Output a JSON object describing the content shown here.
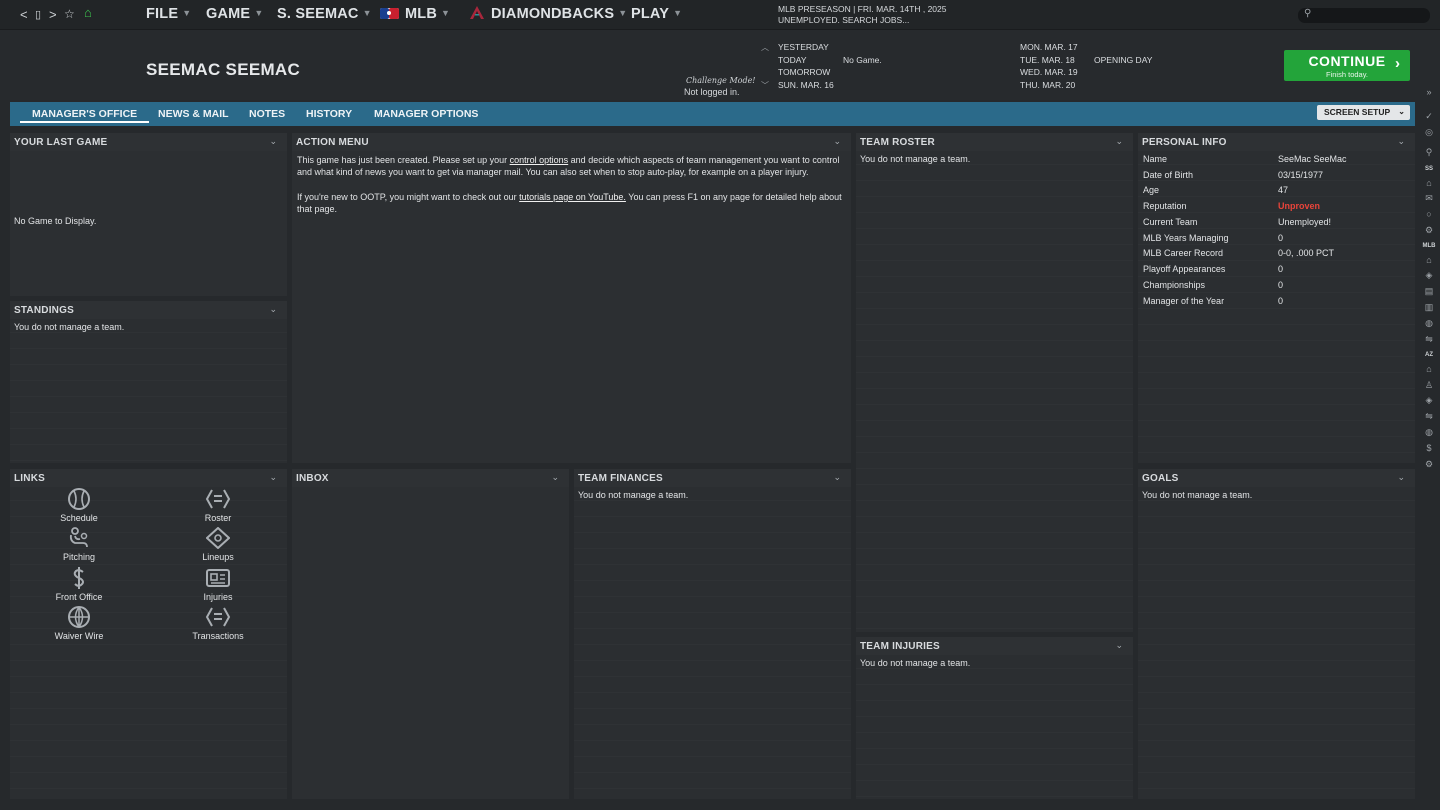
{
  "nav": {
    "back": "<",
    "forward": ">",
    "menus": [
      {
        "label": "FILE"
      },
      {
        "label": "GAME"
      },
      {
        "label": "S. SEEMAC"
      },
      {
        "label": "MLB"
      },
      {
        "label": "DIAMONDBACKS"
      },
      {
        "label": "PLAY"
      }
    ]
  },
  "status": {
    "line1": "MLB PRESEASON  |  FRI. MAR. 14TH , 2025",
    "line2": "UNEMPLOYED. SEARCH JOBS..."
  },
  "header": {
    "manager_name": "SEEMAC SEEMAC",
    "challenge_mode": "Challenge Mode!",
    "logged_in": "Not logged in."
  },
  "schedule": {
    "yesterday": "YESTERDAY",
    "today": "TODAY",
    "today_result": "No Game.",
    "tomorrow": "TOMORROW",
    "sun": "SUN. MAR. 16",
    "mon": "MON. MAR. 17",
    "tue": "TUE. MAR. 18",
    "wed": "WED. MAR. 19",
    "thu": "THU. MAR. 20",
    "opening_day": "OPENING DAY"
  },
  "continue": {
    "label": "CONTINUE",
    "sub": "Finish today."
  },
  "tabs": {
    "managers_office": "MANAGER'S OFFICE",
    "news_mail": "NEWS & MAIL",
    "notes": "NOTES",
    "history": "HISTORY",
    "manager_options": "MANAGER OPTIONS",
    "screen_setup": "SCREEN SETUP"
  },
  "panels": {
    "last_game": {
      "title": "YOUR LAST GAME",
      "text": "No Game to Display."
    },
    "standings": {
      "title": "STANDINGS",
      "text": "You do not manage a team."
    },
    "action_menu": {
      "title": "ACTION MENU",
      "p1_a": "This game has just been created. Please set up your ",
      "p1_link": "control options",
      "p1_b": " and decide which aspects of team management you want to control and what kind of news you want to get via manager mail. You can also set when to stop auto-play, for example on a player injury.",
      "p2_a": "If you're new to OOTP, you might want to check out our ",
      "p2_link": "tutorials page on YouTube.",
      "p2_b": " You can press F1 on any page for detailed help about that page."
    },
    "team_roster": {
      "title": "TEAM ROSTER",
      "text": "You do not manage a team."
    },
    "personal_info": {
      "title": "PERSONAL INFO",
      "rows": [
        {
          "label": "Name",
          "value": "SeeMac SeeMac"
        },
        {
          "label": "Date of Birth",
          "value": "03/15/1977"
        },
        {
          "label": "Age",
          "value": "47"
        },
        {
          "label": "Reputation",
          "value": "Unproven"
        },
        {
          "label": "Current Team",
          "value": "Unemployed!"
        },
        {
          "label": "MLB Years Managing",
          "value": "0"
        },
        {
          "label": "MLB Career Record",
          "value": "0-0, .000 PCT"
        },
        {
          "label": "Playoff Appearances",
          "value": "0"
        },
        {
          "label": "Championships",
          "value": "0"
        },
        {
          "label": "Manager of the Year",
          "value": "0"
        }
      ]
    },
    "links": {
      "title": "LINKS",
      "items": [
        {
          "label": "Schedule",
          "icon": "baseball-icon"
        },
        {
          "label": "Roster",
          "icon": "roster-icon"
        },
        {
          "label": "Pitching",
          "icon": "pitching-icon"
        },
        {
          "label": "Lineups",
          "icon": "diamond-icon"
        },
        {
          "label": "Front Office",
          "icon": "dollar-icon"
        },
        {
          "label": "Injuries",
          "icon": "injuries-icon"
        },
        {
          "label": "Waiver Wire",
          "icon": "globe-icon"
        },
        {
          "label": "Transactions",
          "icon": "transactions-icon"
        }
      ]
    },
    "inbox": {
      "title": "INBOX"
    },
    "team_finances": {
      "title": "TEAM FINANCES",
      "text": "You do not manage a team."
    },
    "team_injuries": {
      "title": "TEAM INJURIES",
      "text": "You do not manage a team."
    },
    "goals": {
      "title": "GOALS",
      "text": "You do not manage a team."
    }
  },
  "sidebar": {
    "ss": "SS",
    "mlb": "MLB",
    "az": "AZ"
  },
  "colors": {
    "tab_bar": "#2b6a8a",
    "continue": "#23a43a",
    "reputation": "#e8443a"
  }
}
